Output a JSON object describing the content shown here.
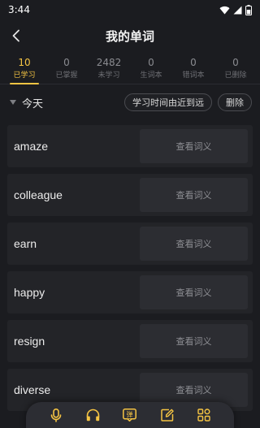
{
  "status_bar": {
    "time": "3:44"
  },
  "header": {
    "title": "我的单词"
  },
  "tabs": [
    {
      "count": "10",
      "label": "已学习"
    },
    {
      "count": "0",
      "label": "已掌握"
    },
    {
      "count": "2482",
      "label": "未学习"
    },
    {
      "count": "0",
      "label": "生词本"
    },
    {
      "count": "0",
      "label": "错词本"
    },
    {
      "count": "0",
      "label": "已删除"
    }
  ],
  "filter": {
    "section_title": "今天",
    "sort_label": "学习时间由近到远",
    "delete_label": "删除"
  },
  "words": [
    {
      "word": "amaze",
      "action": "查看词义"
    },
    {
      "word": "colleague",
      "action": "查看词义"
    },
    {
      "word": "earn",
      "action": "查看词义"
    },
    {
      "word": "happy",
      "action": "查看词义"
    },
    {
      "word": "resign",
      "action": "查看词义"
    },
    {
      "word": "diverse",
      "action": "查看词义"
    }
  ],
  "bottom_nav": {
    "items": [
      {
        "icon": "microphone-icon"
      },
      {
        "icon": "headphones-icon"
      },
      {
        "icon": "bullet-screen-icon",
        "glyph": "弹"
      },
      {
        "icon": "edit-icon"
      },
      {
        "icon": "apps-grid-icon"
      }
    ]
  },
  "colors": {
    "accent": "#f5c443",
    "background": "#1b1c20",
    "card": "#232428"
  }
}
